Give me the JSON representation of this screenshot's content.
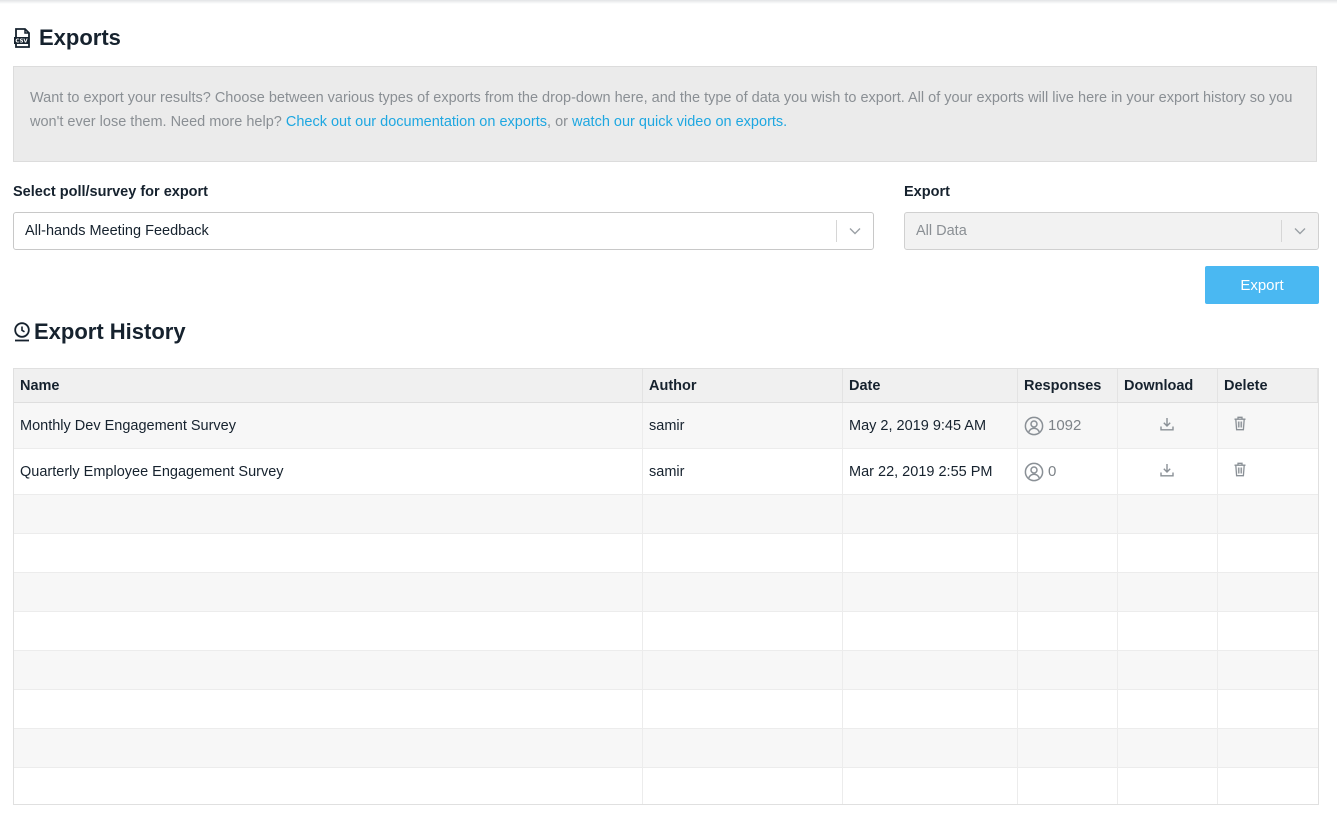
{
  "exports": {
    "title": "Exports",
    "icon": "csv-file-icon",
    "info_text": "Want to export your results? Choose between various types of exports from the drop-down here, and the type of data you wish to export. All of your exports will live here in your export history so you won't ever lose them. Need more help? ",
    "doc_link": "Check out our documentation on exports",
    "separator": ", or ",
    "video_link": "watch our quick video on exports."
  },
  "form": {
    "poll_label": "Select poll/survey for export",
    "poll_value": "All-hands Meeting Feedback",
    "export_label": "Export",
    "export_value": "All Data",
    "export_button": "Export"
  },
  "history": {
    "title": "Export History",
    "icon": "history-clock-icon",
    "columns": [
      "Name",
      "Author",
      "Date",
      "Responses",
      "Download",
      "Delete"
    ],
    "rows": [
      {
        "name": "Monthly Dev Engagement Survey",
        "author": "samir",
        "date": "May 2, 2019 9:45 AM",
        "responses": "1092"
      },
      {
        "name": "Quarterly Employee Engagement Survey",
        "author": "samir",
        "date": "Mar 22, 2019 2:55 PM",
        "responses": "0"
      }
    ]
  },
  "colors": {
    "accent": "#4ab8f2",
    "link": "#1ea7e1",
    "title": "#16222e"
  }
}
